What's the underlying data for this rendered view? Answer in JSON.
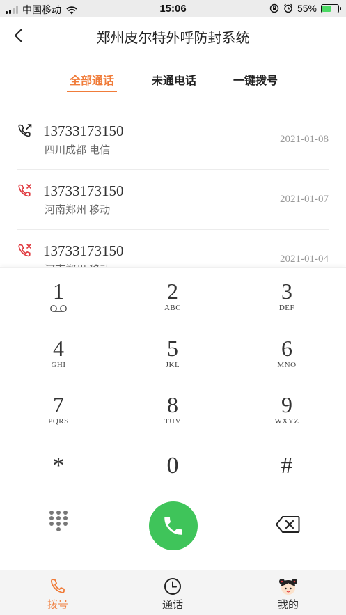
{
  "status_bar": {
    "carrier": "中国移动",
    "time": "15:06",
    "battery": "55%",
    "battery_level": 0.55
  },
  "header": {
    "title": "郑州皮尔特外呼防封系统"
  },
  "tabs": [
    {
      "label": "全部通话",
      "active": true
    },
    {
      "label": "未通电话",
      "active": false
    },
    {
      "label": "一键拨号",
      "active": false
    }
  ],
  "calls": [
    {
      "number": "13733173150",
      "location": "四川成都 电信",
      "date": "2021-01-08",
      "status": "outgoing"
    },
    {
      "number": "13733173150",
      "location": "河南郑州 移动",
      "date": "2021-01-07",
      "status": "missed"
    },
    {
      "number": "13733173150",
      "location": "河南郑州 移动",
      "date": "2021-01-04",
      "status": "missed"
    }
  ],
  "keypad": {
    "keys": [
      {
        "digit": "1",
        "letters": ""
      },
      {
        "digit": "2",
        "letters": "ABC"
      },
      {
        "digit": "3",
        "letters": "DEF"
      },
      {
        "digit": "4",
        "letters": "GHI"
      },
      {
        "digit": "5",
        "letters": "JKL"
      },
      {
        "digit": "6",
        "letters": "MNO"
      },
      {
        "digit": "7",
        "letters": "PQRS"
      },
      {
        "digit": "8",
        "letters": "TUV"
      },
      {
        "digit": "9",
        "letters": "WXYZ"
      },
      {
        "digit": "*",
        "letters": ""
      },
      {
        "digit": "0",
        "letters": ""
      },
      {
        "digit": "#",
        "letters": ""
      }
    ],
    "call_color": "#3fc45a"
  },
  "bottom_nav": [
    {
      "label": "拨号",
      "icon": "phone-icon",
      "active": true
    },
    {
      "label": "通话",
      "icon": "clock-icon",
      "active": false
    },
    {
      "label": "我的",
      "icon": "avatar-icon",
      "active": false
    }
  ],
  "colors": {
    "accent": "#f07c3a",
    "missed": "#e0383e",
    "call_green": "#3fc45a"
  }
}
